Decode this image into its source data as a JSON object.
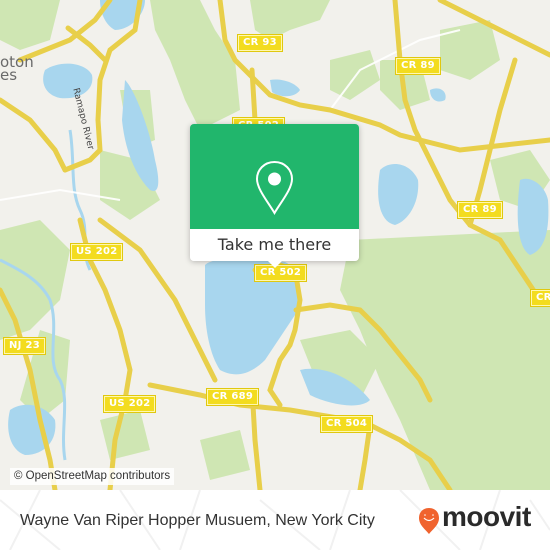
{
  "map": {
    "place_labels": [
      {
        "text": "Pompton",
        "visible_text": "oton"
      },
      {
        "text": "Lakes",
        "visible_text": "es"
      }
    ],
    "water_labels": [
      {
        "text": "Ramapo River"
      }
    ],
    "road_labels": [
      {
        "id": "cr93",
        "text": "CR 93"
      },
      {
        "id": "cr89-top",
        "text": "CR 89"
      },
      {
        "id": "cr89-mid",
        "text": "CR 89"
      },
      {
        "id": "cr-right",
        "text": "CR"
      },
      {
        "id": "cr502-top",
        "text": "CR 502"
      },
      {
        "id": "cr502",
        "text": "CR 502"
      },
      {
        "id": "us202-top",
        "text": "US 202"
      },
      {
        "id": "us202-bottom",
        "text": "US 202"
      },
      {
        "id": "nj23",
        "text": "NJ 23"
      },
      {
        "id": "cr689",
        "text": "CR 689"
      },
      {
        "id": "cr504",
        "text": "CR 504"
      }
    ],
    "attribution": "© OpenStreetMap contributors",
    "colors": {
      "land": "#f2f1ec",
      "forest": "#cfe6b3",
      "water": "#a8d6ee",
      "road": "#f5e36a",
      "road_label": "#f3dc1f"
    }
  },
  "popup": {
    "icon": "map-pin-icon",
    "button_label": "Take me there",
    "color": "#21b66c"
  },
  "footer": {
    "title": "Wayne Van Riper Hopper Musuem, New York City",
    "brand": "moovit",
    "brand_color": "#f0632e"
  }
}
